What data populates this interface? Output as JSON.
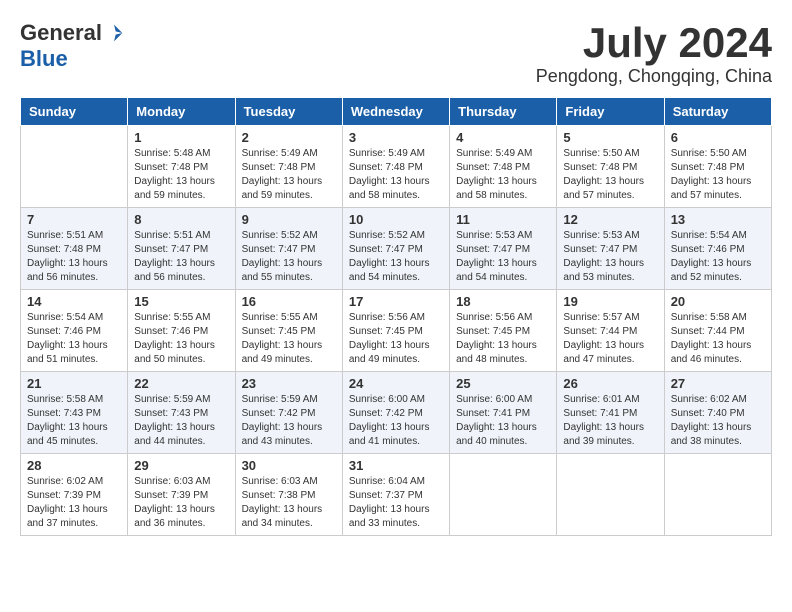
{
  "header": {
    "logo_general": "General",
    "logo_blue": "Blue",
    "month_year": "July 2024",
    "location": "Pengdong, Chongqing, China"
  },
  "weekdays": [
    "Sunday",
    "Monday",
    "Tuesday",
    "Wednesday",
    "Thursday",
    "Friday",
    "Saturday"
  ],
  "weeks": [
    [
      {
        "day": "",
        "sunrise": "",
        "sunset": "",
        "daylight": ""
      },
      {
        "day": "1",
        "sunrise": "Sunrise: 5:48 AM",
        "sunset": "Sunset: 7:48 PM",
        "daylight": "Daylight: 13 hours and 59 minutes."
      },
      {
        "day": "2",
        "sunrise": "Sunrise: 5:49 AM",
        "sunset": "Sunset: 7:48 PM",
        "daylight": "Daylight: 13 hours and 59 minutes."
      },
      {
        "day": "3",
        "sunrise": "Sunrise: 5:49 AM",
        "sunset": "Sunset: 7:48 PM",
        "daylight": "Daylight: 13 hours and 58 minutes."
      },
      {
        "day": "4",
        "sunrise": "Sunrise: 5:49 AM",
        "sunset": "Sunset: 7:48 PM",
        "daylight": "Daylight: 13 hours and 58 minutes."
      },
      {
        "day": "5",
        "sunrise": "Sunrise: 5:50 AM",
        "sunset": "Sunset: 7:48 PM",
        "daylight": "Daylight: 13 hours and 57 minutes."
      },
      {
        "day": "6",
        "sunrise": "Sunrise: 5:50 AM",
        "sunset": "Sunset: 7:48 PM",
        "daylight": "Daylight: 13 hours and 57 minutes."
      }
    ],
    [
      {
        "day": "7",
        "sunrise": "Sunrise: 5:51 AM",
        "sunset": "Sunset: 7:48 PM",
        "daylight": "Daylight: 13 hours and 56 minutes."
      },
      {
        "day": "8",
        "sunrise": "Sunrise: 5:51 AM",
        "sunset": "Sunset: 7:47 PM",
        "daylight": "Daylight: 13 hours and 56 minutes."
      },
      {
        "day": "9",
        "sunrise": "Sunrise: 5:52 AM",
        "sunset": "Sunset: 7:47 PM",
        "daylight": "Daylight: 13 hours and 55 minutes."
      },
      {
        "day": "10",
        "sunrise": "Sunrise: 5:52 AM",
        "sunset": "Sunset: 7:47 PM",
        "daylight": "Daylight: 13 hours and 54 minutes."
      },
      {
        "day": "11",
        "sunrise": "Sunrise: 5:53 AM",
        "sunset": "Sunset: 7:47 PM",
        "daylight": "Daylight: 13 hours and 54 minutes."
      },
      {
        "day": "12",
        "sunrise": "Sunrise: 5:53 AM",
        "sunset": "Sunset: 7:47 PM",
        "daylight": "Daylight: 13 hours and 53 minutes."
      },
      {
        "day": "13",
        "sunrise": "Sunrise: 5:54 AM",
        "sunset": "Sunset: 7:46 PM",
        "daylight": "Daylight: 13 hours and 52 minutes."
      }
    ],
    [
      {
        "day": "14",
        "sunrise": "Sunrise: 5:54 AM",
        "sunset": "Sunset: 7:46 PM",
        "daylight": "Daylight: 13 hours and 51 minutes."
      },
      {
        "day": "15",
        "sunrise": "Sunrise: 5:55 AM",
        "sunset": "Sunset: 7:46 PM",
        "daylight": "Daylight: 13 hours and 50 minutes."
      },
      {
        "day": "16",
        "sunrise": "Sunrise: 5:55 AM",
        "sunset": "Sunset: 7:45 PM",
        "daylight": "Daylight: 13 hours and 49 minutes."
      },
      {
        "day": "17",
        "sunrise": "Sunrise: 5:56 AM",
        "sunset": "Sunset: 7:45 PM",
        "daylight": "Daylight: 13 hours and 49 minutes."
      },
      {
        "day": "18",
        "sunrise": "Sunrise: 5:56 AM",
        "sunset": "Sunset: 7:45 PM",
        "daylight": "Daylight: 13 hours and 48 minutes."
      },
      {
        "day": "19",
        "sunrise": "Sunrise: 5:57 AM",
        "sunset": "Sunset: 7:44 PM",
        "daylight": "Daylight: 13 hours and 47 minutes."
      },
      {
        "day": "20",
        "sunrise": "Sunrise: 5:58 AM",
        "sunset": "Sunset: 7:44 PM",
        "daylight": "Daylight: 13 hours and 46 minutes."
      }
    ],
    [
      {
        "day": "21",
        "sunrise": "Sunrise: 5:58 AM",
        "sunset": "Sunset: 7:43 PM",
        "daylight": "Daylight: 13 hours and 45 minutes."
      },
      {
        "day": "22",
        "sunrise": "Sunrise: 5:59 AM",
        "sunset": "Sunset: 7:43 PM",
        "daylight": "Daylight: 13 hours and 44 minutes."
      },
      {
        "day": "23",
        "sunrise": "Sunrise: 5:59 AM",
        "sunset": "Sunset: 7:42 PM",
        "daylight": "Daylight: 13 hours and 43 minutes."
      },
      {
        "day": "24",
        "sunrise": "Sunrise: 6:00 AM",
        "sunset": "Sunset: 7:42 PM",
        "daylight": "Daylight: 13 hours and 41 minutes."
      },
      {
        "day": "25",
        "sunrise": "Sunrise: 6:00 AM",
        "sunset": "Sunset: 7:41 PM",
        "daylight": "Daylight: 13 hours and 40 minutes."
      },
      {
        "day": "26",
        "sunrise": "Sunrise: 6:01 AM",
        "sunset": "Sunset: 7:41 PM",
        "daylight": "Daylight: 13 hours and 39 minutes."
      },
      {
        "day": "27",
        "sunrise": "Sunrise: 6:02 AM",
        "sunset": "Sunset: 7:40 PM",
        "daylight": "Daylight: 13 hours and 38 minutes."
      }
    ],
    [
      {
        "day": "28",
        "sunrise": "Sunrise: 6:02 AM",
        "sunset": "Sunset: 7:39 PM",
        "daylight": "Daylight: 13 hours and 37 minutes."
      },
      {
        "day": "29",
        "sunrise": "Sunrise: 6:03 AM",
        "sunset": "Sunset: 7:39 PM",
        "daylight": "Daylight: 13 hours and 36 minutes."
      },
      {
        "day": "30",
        "sunrise": "Sunrise: 6:03 AM",
        "sunset": "Sunset: 7:38 PM",
        "daylight": "Daylight: 13 hours and 34 minutes."
      },
      {
        "day": "31",
        "sunrise": "Sunrise: 6:04 AM",
        "sunset": "Sunset: 7:37 PM",
        "daylight": "Daylight: 13 hours and 33 minutes."
      },
      {
        "day": "",
        "sunrise": "",
        "sunset": "",
        "daylight": ""
      },
      {
        "day": "",
        "sunrise": "",
        "sunset": "",
        "daylight": ""
      },
      {
        "day": "",
        "sunrise": "",
        "sunset": "",
        "daylight": ""
      }
    ]
  ]
}
